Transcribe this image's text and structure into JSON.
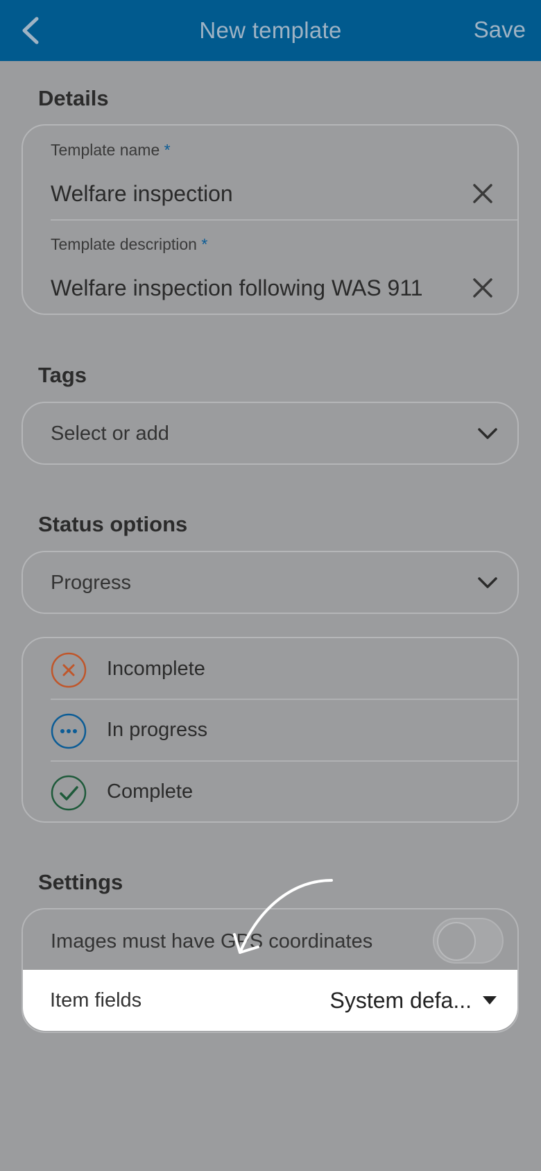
{
  "header": {
    "title": "New template",
    "save_label": "Save",
    "back_icon": "chevron-left-icon",
    "bg_color": "#015a8e"
  },
  "details": {
    "section_title": "Details",
    "name_label": "Template name",
    "name_required": "*",
    "name_value": "Welfare inspection",
    "description_label": "Template description",
    "description_required": "*",
    "description_value": "Welfare inspection following WAS 911"
  },
  "tags": {
    "section_title": "Tags",
    "placeholder": "Select or add"
  },
  "status_options": {
    "section_title": "Status options",
    "selected": "Progress",
    "items": [
      {
        "label": "Incomplete",
        "icon": "x-circle-icon",
        "color": "#c0562a"
      },
      {
        "label": "In progress",
        "icon": "dots-circle-icon",
        "color": "#0b5c96"
      },
      {
        "label": "Complete",
        "icon": "check-circle-icon",
        "color": "#1e5a3a"
      }
    ]
  },
  "settings": {
    "section_title": "Settings",
    "gps_label": "Images must have GPS coordinates",
    "gps_enabled": false,
    "item_fields_label": "Item fields",
    "item_fields_value": "System defa..."
  }
}
